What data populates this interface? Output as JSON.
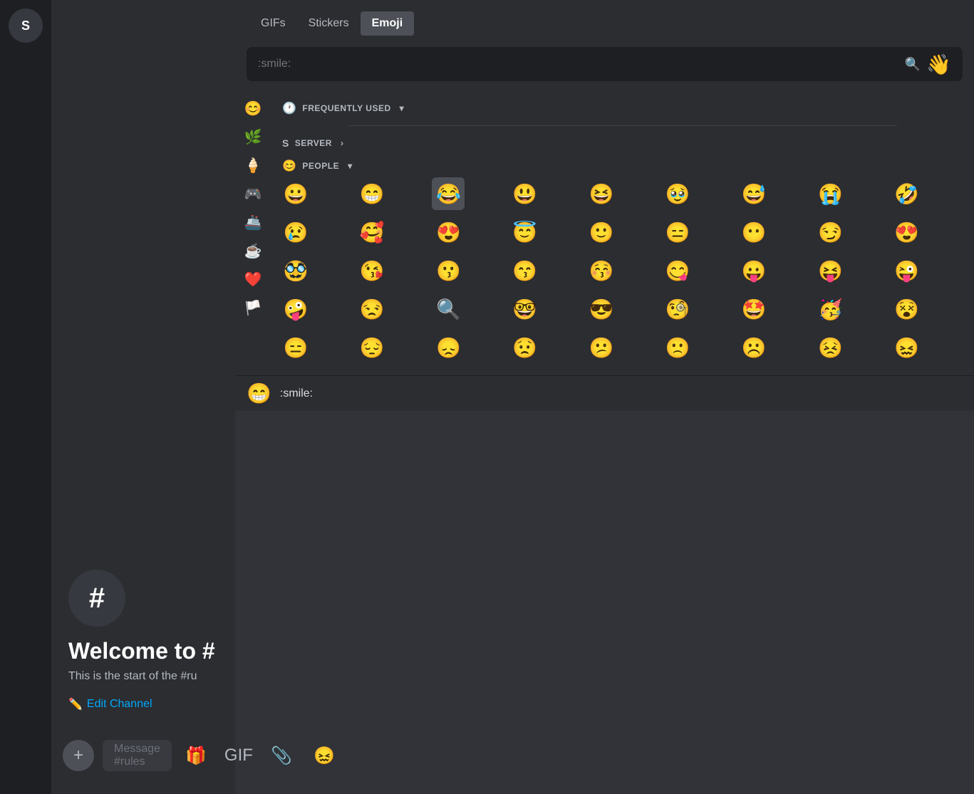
{
  "server": {
    "icon_label": "S"
  },
  "channel": {
    "name": "rules",
    "welcome_title": "Welcome to #",
    "welcome_desc": "This is the start of the #ru",
    "edit_channel_label": "Edit Channel",
    "message_placeholder": "Message #rules"
  },
  "emoji_picker": {
    "tabs": [
      {
        "id": "gifs",
        "label": "GIFs",
        "active": false
      },
      {
        "id": "stickers",
        "label": "Stickers",
        "active": false
      },
      {
        "id": "emoji",
        "label": "Emoji",
        "active": true
      }
    ],
    "search_value": ":smile:",
    "search_placeholder": ":smile:",
    "wave_emoji": "👋",
    "sections": [
      {
        "id": "frequently-used",
        "icon": "🕐",
        "label": "FREQUENTLY USED",
        "expand": "chevron-down"
      },
      {
        "id": "server",
        "icon": "S",
        "label": "SERVER",
        "expand": "arrow-right"
      },
      {
        "id": "people",
        "icon": "😊",
        "label": "PEOPLE",
        "expand": "chevron-down"
      }
    ],
    "left_nav": [
      {
        "id": "people",
        "icon": "😊"
      },
      {
        "id": "nature",
        "icon": "🌿"
      },
      {
        "id": "food",
        "icon": "🍦"
      },
      {
        "id": "activities",
        "icon": "🎮"
      },
      {
        "id": "travel",
        "icon": "🚢"
      },
      {
        "id": "objects",
        "icon": "☕"
      },
      {
        "id": "symbols",
        "icon": "❤️"
      },
      {
        "id": "flags",
        "icon": "🏳️"
      }
    ],
    "emoji_rows": [
      [
        "😀",
        "😁",
        "😂",
        "😃",
        "😆",
        "🥹",
        "😅",
        "😭",
        "🤣"
      ],
      [
        "😢",
        "🥰",
        "😍",
        "😇",
        "🙂",
        "😑",
        "😶",
        "😏",
        "😍"
      ],
      [
        "🥸",
        "😘",
        "😗",
        "😙",
        "😚",
        "😋",
        "😛",
        "😝",
        "😜"
      ],
      [
        "🤪",
        "😒",
        "🔍",
        "🤓",
        "😎",
        "🧐",
        "🤩",
        "🥳",
        "😵"
      ],
      [
        "😑",
        "😔",
        "😞",
        "😟",
        "😕",
        "🙁",
        "☹️",
        "😣",
        "😖"
      ]
    ],
    "selected_emoji_index": {
      "row": 0,
      "col": 2
    },
    "bottom_preview": {
      "emoji": "😁",
      "label": ":smile:"
    }
  },
  "toolbar": {
    "add_icon": "+",
    "gift_icon": "🎁",
    "gif_label": "GIF",
    "attachment_icon": "📎",
    "current_emoji": "😖"
  }
}
